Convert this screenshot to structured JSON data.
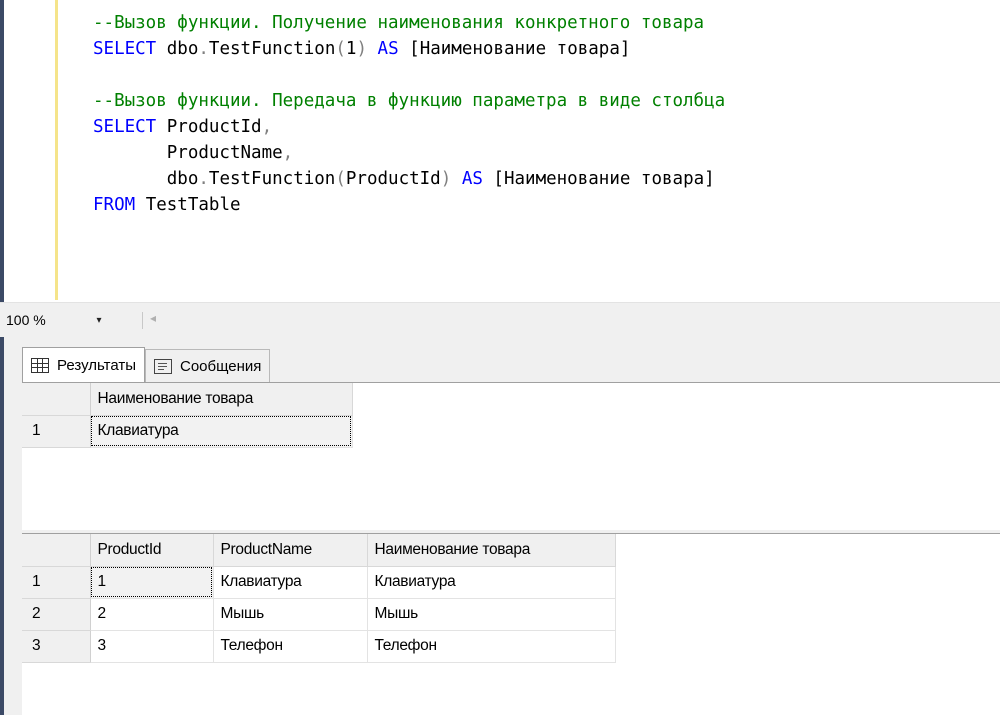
{
  "editor": {
    "lines": [
      [
        {
          "t": "--Вызов функции. Получение наименования конкретного товара",
          "c": "cmt"
        }
      ],
      [
        {
          "t": "SELECT",
          "c": "kw"
        },
        {
          "t": " dbo",
          "c": "plain"
        },
        {
          "t": ".",
          "c": "gr"
        },
        {
          "t": "TestFunction",
          "c": "plain"
        },
        {
          "t": "(",
          "c": "gr"
        },
        {
          "t": "1",
          "c": "plain"
        },
        {
          "t": ")",
          "c": "gr"
        },
        {
          "t": " ",
          "c": "plain"
        },
        {
          "t": "AS",
          "c": "kw"
        },
        {
          "t": " [Наименование товара]",
          "c": "plain"
        }
      ],
      [],
      [
        {
          "t": "--Вызов функции. Передача в функцию параметра в виде столбца",
          "c": "cmt"
        }
      ],
      [
        {
          "t": "SELECT",
          "c": "kw"
        },
        {
          "t": " ProductId",
          "c": "plain"
        },
        {
          "t": ",",
          "c": "gr"
        }
      ],
      [
        {
          "t": "       ProductName",
          "c": "plain"
        },
        {
          "t": ",",
          "c": "gr"
        }
      ],
      [
        {
          "t": "       dbo",
          "c": "plain"
        },
        {
          "t": ".",
          "c": "gr"
        },
        {
          "t": "TestFunction",
          "c": "plain"
        },
        {
          "t": "(",
          "c": "gr"
        },
        {
          "t": "ProductId",
          "c": "plain"
        },
        {
          "t": ")",
          "c": "gr"
        },
        {
          "t": " ",
          "c": "plain"
        },
        {
          "t": "AS",
          "c": "kw"
        },
        {
          "t": " [Наименование товара]",
          "c": "plain"
        }
      ],
      [
        {
          "t": "FROM",
          "c": "kw"
        },
        {
          "t": " TestTable",
          "c": "plain"
        }
      ]
    ]
  },
  "zoom": {
    "value": "100 %",
    "dropdown_glyph": "▾",
    "scroll_glyph": "◂"
  },
  "tabs": [
    {
      "label": "Результаты",
      "icon": "grid-icon"
    },
    {
      "label": "Сообщения",
      "icon": "messages-icon"
    }
  ],
  "result1": {
    "columns": [
      "Наименование товара"
    ],
    "rows": [
      {
        "num": "1",
        "cells": [
          "Клавиатура"
        ]
      }
    ]
  },
  "result2": {
    "columns": [
      "ProductId",
      "ProductName",
      "Наименование товара"
    ],
    "rows": [
      {
        "num": "1",
        "cells": [
          "1",
          "Клавиатура",
          "Клавиатура"
        ]
      },
      {
        "num": "2",
        "cells": [
          "2",
          "Мышь",
          "Мышь"
        ]
      },
      {
        "num": "3",
        "cells": [
          "3",
          "Телефон",
          "Телефон"
        ]
      }
    ]
  },
  "colors": {
    "comment": "#008000",
    "keyword": "#0000ff",
    "punctuation": "#808080",
    "margin": "#f5e48a"
  }
}
